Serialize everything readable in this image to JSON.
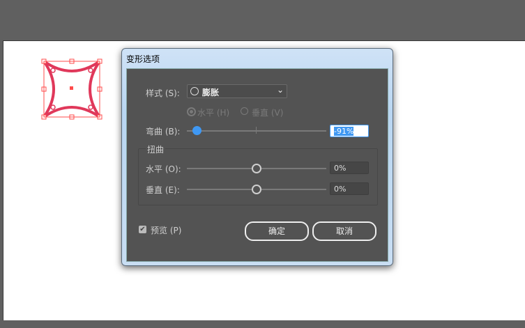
{
  "dialog": {
    "title": "变形选项"
  },
  "style": {
    "label": "样式 (S):",
    "value": "膨胀",
    "icon": "circle-icon"
  },
  "orientation": {
    "horizontal": "水平 (H)",
    "vertical": "垂直 (V)",
    "selected": "horizontal"
  },
  "bend": {
    "label": "弯曲 (B):",
    "value": "-91%",
    "percent": -91
  },
  "distortion": {
    "group_label": "扭曲",
    "horizontal": {
      "label": "水平 (O):",
      "value": "0%",
      "percent": 0
    },
    "vertical": {
      "label": "垂直 (E):",
      "value": "0%",
      "percent": 0
    }
  },
  "preview": {
    "label": "预览 (P)",
    "checked": true
  },
  "buttons": {
    "ok": "确定",
    "cancel": "取消"
  },
  "colors": {
    "accent": "#3f98f3",
    "shape": "#e0385a",
    "selection": "#ff4b4b"
  }
}
